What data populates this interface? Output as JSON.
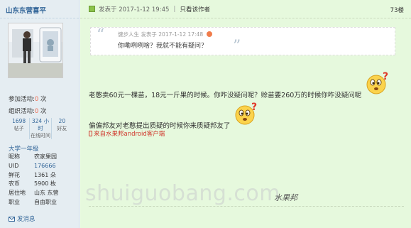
{
  "sidebar": {
    "username": "山东东营喜平",
    "activity": [
      {
        "label": "参加活动:",
        "count": "0",
        "unit": "次"
      },
      {
        "label": "组织活动:",
        "count": "0",
        "unit": "次"
      }
    ],
    "stats": [
      {
        "value": "1698",
        "label": "帖子"
      },
      {
        "value": "324 小时",
        "label": "在线时间"
      },
      {
        "value": "20",
        "label": "好友"
      }
    ],
    "level": "大学一年级",
    "info": [
      {
        "key": "昵称",
        "value": "农家果园"
      },
      {
        "key": "UID",
        "value": "176666"
      },
      {
        "key": "鲜花",
        "value": "1361 朵"
      },
      {
        "key": "农币",
        "value": "5900 枚"
      },
      {
        "key": "居住地",
        "value": "山东 东营"
      },
      {
        "key": "职业",
        "value": "自由职业"
      }
    ],
    "send_message": "发消息"
  },
  "post": {
    "posted_at": "发表于  2017-1-12 19:45",
    "separator": "|",
    "author_only": "只看该作者",
    "floor": "73楼",
    "quote": {
      "author": "健步人生",
      "time": "发表于  2017-1-12 17:48",
      "text": "你嘞咧咧啥？我就不能有疑问？"
    },
    "line1": "老憨卖60元一棵苗，18元一斤果的时候。你咋没疑问呢？赊苗要260万的时候你咋没疑问呢",
    "line2": "偏偏邦友对老憨提出质疑的时候你来质疑邦友了",
    "from_client": "来自水果邦android客户端"
  },
  "watermark": {
    "latin": "shuiguobang.com",
    "chinese": "水果邦"
  },
  "colors": {
    "link": "#336699",
    "post_bg": "#e6f9dd",
    "sidebar_bg": "#e5edf2",
    "accent_red": "#d0352a"
  }
}
